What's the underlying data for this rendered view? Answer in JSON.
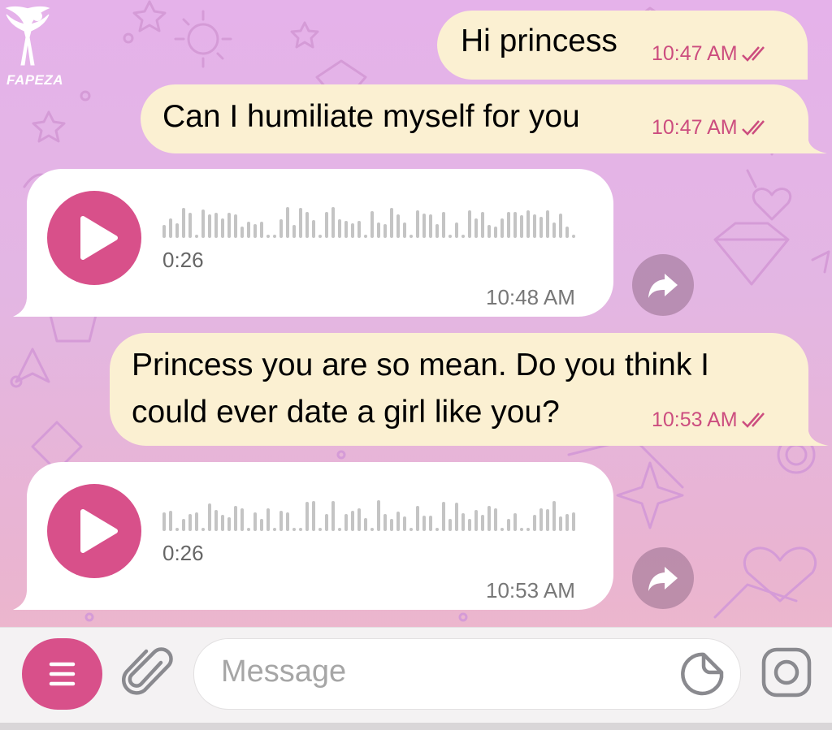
{
  "watermark": "FAPEZA",
  "messages": [
    {
      "type": "text",
      "from": "me",
      "text": "Hi princess",
      "time": "10:47 AM"
    },
    {
      "type": "text",
      "from": "me",
      "text": "Can I humiliate myself for you",
      "time": "10:47 AM"
    },
    {
      "type": "voice",
      "from": "them",
      "duration": "0:26",
      "time": "10:48 AM"
    },
    {
      "type": "text",
      "from": "me",
      "lines": [
        "Princess you are so mean. Do you think I",
        "could ever date a girl like you?"
      ],
      "time": "10:53 AM"
    },
    {
      "type": "voice",
      "from": "them",
      "duration": "0:26",
      "time": "10:53 AM"
    }
  ],
  "composer": {
    "placeholder": "Message"
  },
  "icons": {
    "read_status": "double-check-icon",
    "play": "play-icon",
    "forward": "forward-icon",
    "menu": "menu-icon",
    "attach": "paperclip-icon",
    "sticker": "sticker-icon",
    "camera": "camera-icon"
  },
  "colors": {
    "accent": "#d8508a",
    "outgoing_bubble": "#fbf0d2",
    "incoming_bubble": "#ffffff",
    "timestamp_out": "#cc4d7f"
  }
}
